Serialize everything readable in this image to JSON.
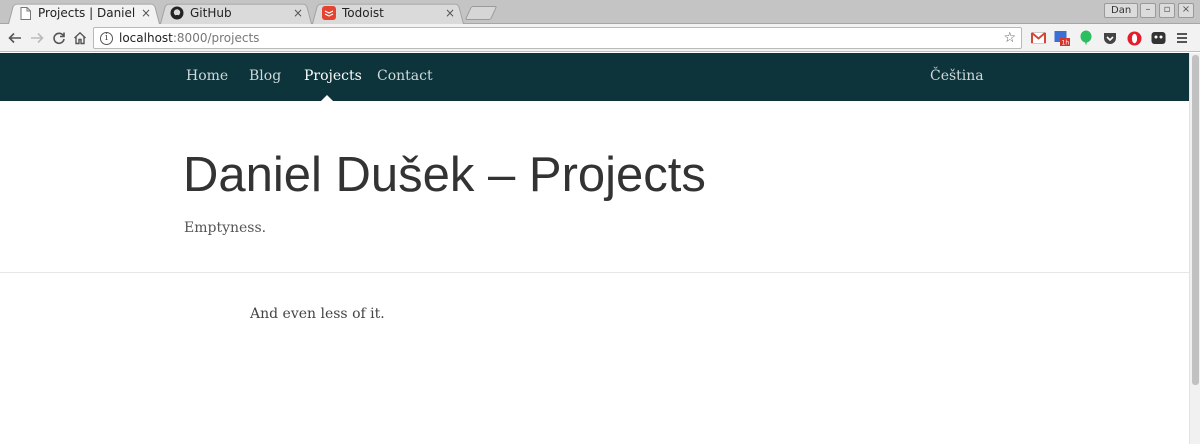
{
  "browser": {
    "tabs": [
      {
        "title": "Projects | Daniel Du",
        "icon": "page-icon",
        "active": true
      },
      {
        "title": "GitHub",
        "icon": "github-icon",
        "active": false
      },
      {
        "title": "Todoist",
        "icon": "todoist-icon",
        "active": false
      }
    ],
    "close_glyph": "×",
    "profile_name": "Dan",
    "url_host": "localhost",
    "url_path": ":8000/projects",
    "extensions": [
      "gmail-icon",
      "calendar-icon",
      "evernote-icon",
      "pocket-icon",
      "opera-icon",
      "ghostery-icon",
      "menu-icon"
    ],
    "calendar_badge": "1h"
  },
  "site": {
    "nav": [
      {
        "label": "Home",
        "active": false
      },
      {
        "label": "Blog",
        "active": false
      },
      {
        "label": "Projects",
        "active": true
      },
      {
        "label": "Contact",
        "active": false
      }
    ],
    "language_link": "Čeština",
    "title": "Daniel Dušek – Projects",
    "subtitle": "Emptyness.",
    "body": "And even less of it."
  }
}
